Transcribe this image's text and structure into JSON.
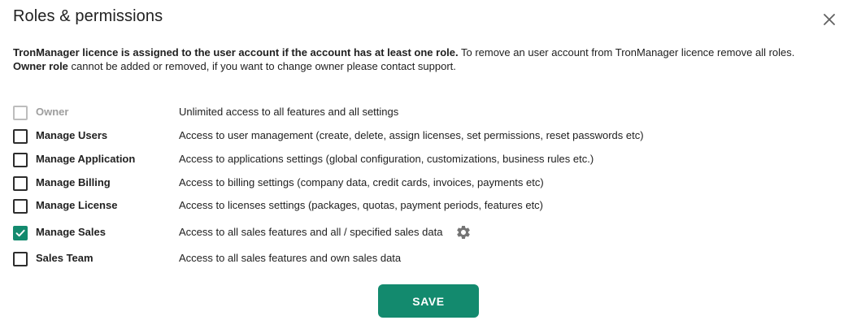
{
  "dialog": {
    "title": "Roles & permissions",
    "info_line1_bold": "TronManager licence is assigned to the user account if the account has at least one role.",
    "info_line1_rest": " To remove an user account from TronManager licence remove all roles.",
    "info_line2_bold": "Owner role",
    "info_line2_rest": " cannot be added or removed, if you want to change owner please contact support."
  },
  "roles": [
    {
      "label": "Owner",
      "description": "Unlimited access to all features and all settings",
      "checked": false,
      "disabled": true
    },
    {
      "label": "Manage Users",
      "description": "Access to user management (create, delete, assign licenses, set permissions, reset passwords etc)",
      "checked": false,
      "disabled": false
    },
    {
      "label": "Manage Application",
      "description": "Access to applications settings (global configuration, customizations, business rules etc.)",
      "checked": false,
      "disabled": false
    },
    {
      "label": "Manage Billing",
      "description": "Access to billing settings (company data, credit cards, invoices, payments etc)",
      "checked": false,
      "disabled": false
    },
    {
      "label": "Manage License",
      "description": "Access to licenses settings (packages, quotas, payment periods, features etc)",
      "checked": false,
      "disabled": false
    },
    {
      "label": "Manage Sales",
      "description": "Access to all sales features and all / specified sales data",
      "checked": true,
      "disabled": false,
      "settings_icon": "gear-icon"
    },
    {
      "label": "Sales Team",
      "description": "Access to all sales features and own sales data",
      "checked": false,
      "disabled": false
    }
  ],
  "actions": {
    "save_label": "SAVE"
  },
  "colors": {
    "accent": "#138a6e",
    "disabled": "#bdbdbd"
  },
  "icons": {
    "close": "close-icon",
    "checked": "check-icon",
    "settings": "gear-icon"
  }
}
